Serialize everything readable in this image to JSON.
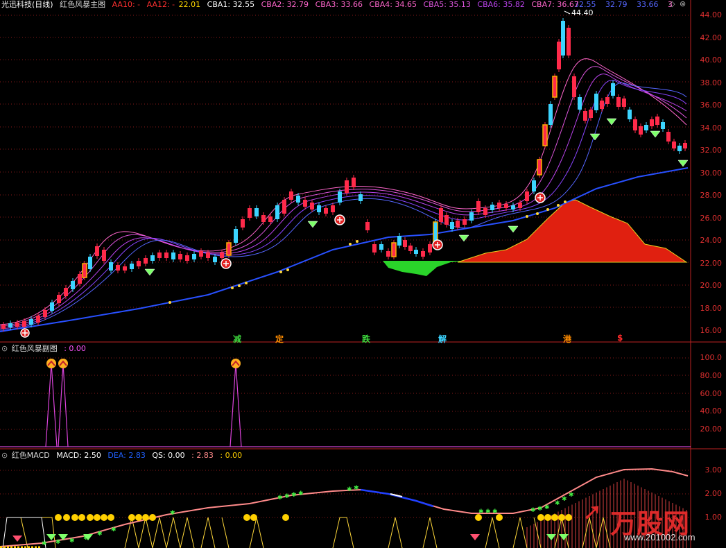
{
  "main": {
    "stock_name": "光迅科技(日线)",
    "indicator": "红色风暴主图",
    "aa10": "AA10: -",
    "aa12": "AA12: -",
    "aa12_value": "22.01",
    "cba1": "CBA1: 32.55",
    "cba2": "CBA2: 32.79",
    "cba3": "CBA3: 33.66",
    "cba4": "CBA4: 34.65",
    "cba5": "CBA5: 35.13",
    "cba6": "CBA6: 35.82",
    "cba7": "CBA7: 36.67",
    "extra1": "32.55",
    "extra2": "32.79",
    "extra3": "33.66",
    "extra4": "3",
    "high_label": "44.40",
    "axis": [
      "44.00",
      "42.00",
      "40.00",
      "38.00",
      "36.00",
      "34.00",
      "32.00",
      "30.00",
      "28.00",
      "26.00",
      "24.00",
      "22.00",
      "20.00",
      "18.00",
      "16.00"
    ],
    "signals": [
      {
        "text": "减",
        "color": "#3cd43c"
      },
      {
        "text": "定",
        "color": "#ff8c00"
      },
      {
        "text": "跌",
        "color": "#3cd43c"
      },
      {
        "text": "解",
        "color": "#3cd4ff"
      },
      {
        "text": "港",
        "color": "#ff8c00"
      },
      {
        "text": "$",
        "color": "#ff2a2a"
      }
    ]
  },
  "sub": {
    "indicator": "红色风暴副图",
    "value": ": 0.00",
    "axis": [
      "100.0",
      "80.00",
      "60.00",
      "40.00",
      "20.00"
    ]
  },
  "macd": {
    "indicator": "红色MACD",
    "macd": "MACD: 2.50",
    "dea": "DEA: 2.83",
    "qs": "QS: 0.00",
    "v1": ": 2.83",
    "v2": ": 0.00",
    "axis": [
      "3.00",
      "2.00",
      "1.00"
    ]
  },
  "watermark": {
    "brand": "万股网",
    "url": "www.201002.com"
  },
  "colors": {
    "up": "#ff2a4a",
    "down": "#3cd4ff",
    "axis": "#e03030",
    "grid": "#8a1a1a"
  }
}
